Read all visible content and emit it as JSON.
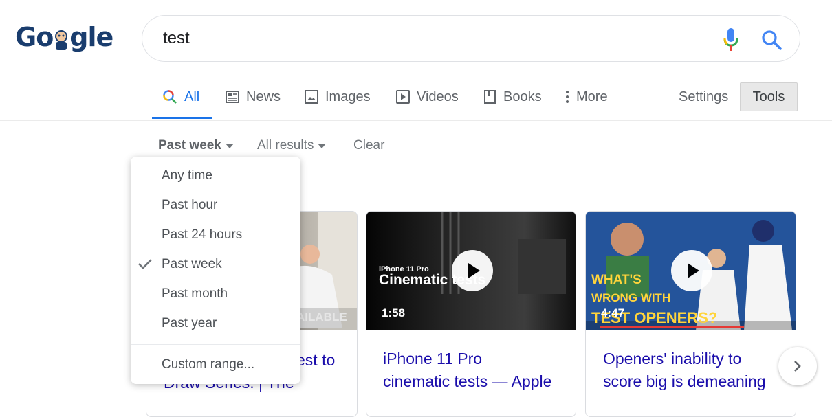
{
  "search": {
    "query": "test"
  },
  "tabs": [
    {
      "label": "All",
      "icon": "search-icon"
    },
    {
      "label": "News",
      "icon": "newspaper-icon"
    },
    {
      "label": "Images",
      "icon": "image-icon"
    },
    {
      "label": "Videos",
      "icon": "play-icon"
    },
    {
      "label": "Books",
      "icon": "book-icon"
    },
    {
      "label": "More",
      "icon": "more-vert-icon"
    }
  ],
  "settings_label": "Settings",
  "tools_label": "Tools",
  "filters": {
    "time": "Past week",
    "results": "All results",
    "clear": "Clear"
  },
  "time_menu": {
    "items": [
      "Any time",
      "Past hour",
      "Past 24 hours",
      "Past week",
      "Past month",
      "Past year"
    ],
    "selected": "Past week",
    "custom": "Custom range..."
  },
  "videos": [
    {
      "title_fragment_1": "est to",
      "title_fragment_2": "Draw Series: | The",
      "overlay": "AILABLE"
    },
    {
      "title_line1": "iPhone 11 Pro",
      "title_line2": "cinematic tests — Apple",
      "duration": "1:58",
      "overlay_small": "iPhone 11 Pro",
      "overlay_big": "Cinematic tests"
    },
    {
      "title_line1": "Openers' inability to",
      "title_line2": "score big is demeaning",
      "duration": "4:47",
      "overlay_line1": "WHAT'S",
      "overlay_line2": "WRONG WITH",
      "overlay_line3": "TEST OPENERS?"
    }
  ],
  "colors": {
    "accent": "#1a73e8",
    "link": "#1a0dab",
    "logo": "#1a3d6e"
  }
}
